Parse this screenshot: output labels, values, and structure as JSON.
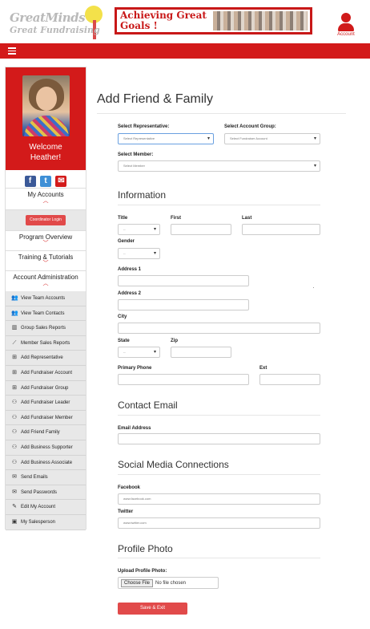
{
  "header": {
    "logo_line1": "GreatMinds",
    "logo_line2": "Great Fundraising",
    "banner_text": "Achieving Great Goals !",
    "account_label": "Account"
  },
  "sidebar": {
    "welcome_line1": "Welcome",
    "welcome_line2": "Heather!",
    "social": {
      "facebook": "f",
      "twitter": "t",
      "email": "✉"
    },
    "my_accounts": "My Accounts",
    "coordinator_login": "Coordinator Login",
    "program_overview": "Program Overview",
    "training": "Training & Tutorials",
    "account_admin": "Account Administration",
    "admin_items": [
      {
        "label": "View Team Accounts",
        "icon": "users-icon",
        "glyph": "👥"
      },
      {
        "label": "View Team Contacts",
        "icon": "users-icon",
        "glyph": "👥"
      },
      {
        "label": "Group Sales Reports",
        "icon": "bar-chart-icon",
        "glyph": "▥"
      },
      {
        "label": "Member Sales Reports",
        "icon": "line-chart-icon",
        "glyph": "⟋"
      },
      {
        "label": "Add Representative",
        "icon": "plus-square-icon",
        "glyph": "⊞"
      },
      {
        "label": "Add Fundraiser Account",
        "icon": "plus-square-icon",
        "glyph": "⊞"
      },
      {
        "label": "Add Fundraiser Group",
        "icon": "plus-square-icon",
        "glyph": "⊞"
      },
      {
        "label": "Add Fundraiser Leader",
        "icon": "user-plus-icon",
        "glyph": "⚇"
      },
      {
        "label": "Add Fundraiser Member",
        "icon": "user-plus-icon",
        "glyph": "⚇"
      },
      {
        "label": "Add Friend Family",
        "icon": "user-plus-icon",
        "glyph": "⚇"
      },
      {
        "label": "Add Business Supporter",
        "icon": "user-plus-icon",
        "glyph": "⚇"
      },
      {
        "label": "Add Business Associate",
        "icon": "user-plus-icon",
        "glyph": "⚇"
      },
      {
        "label": "Send Emails",
        "icon": "envelope-icon",
        "glyph": "✉"
      },
      {
        "label": "Send Passwords",
        "icon": "envelope-icon",
        "glyph": "✉"
      },
      {
        "label": "Edit My Account",
        "icon": "pencil-icon",
        "glyph": "✎"
      },
      {
        "label": "My Salesperson",
        "icon": "briefcase-icon",
        "glyph": "▣"
      }
    ]
  },
  "main": {
    "page_title": "Add Friend & Family",
    "select_rep_label": "Select Representative:",
    "select_rep_value": "Select Representative",
    "select_group_label": "Select Account Group:",
    "select_group_value": "Select Fundraiser Account",
    "select_member_label": "Select Member:",
    "select_member_value": "Select Member",
    "information_title": "Information",
    "title_label": "Title",
    "title_value": "--",
    "first_label": "First",
    "last_label": "Last",
    "gender_label": "Gender",
    "gender_value": "--",
    "address1_label": "Address 1",
    "address2_label": "Address 2",
    "city_label": "City",
    "state_label": "State",
    "state_value": "--",
    "zip_label": "Zip",
    "phone_label": "Primary Phone",
    "ext_label": "Ext",
    "contact_email_title": "Contact Email",
    "email_label": "Email Address",
    "social_title": "Social Media Connections",
    "facebook_label": "Facebook",
    "facebook_placeholder": "www.facebook.com",
    "twitter_label": "Twitter",
    "twitter_placeholder": "www.twitter.com",
    "profile_photo_title": "Profile Photo",
    "upload_label": "Upload Profile Photo:",
    "choose_file": "Choose File",
    "no_file": "No file chosen",
    "save_exit": "Save & Exit"
  },
  "colors": {
    "brand_red": "#d31a1a",
    "button_red": "#e14a4a"
  }
}
